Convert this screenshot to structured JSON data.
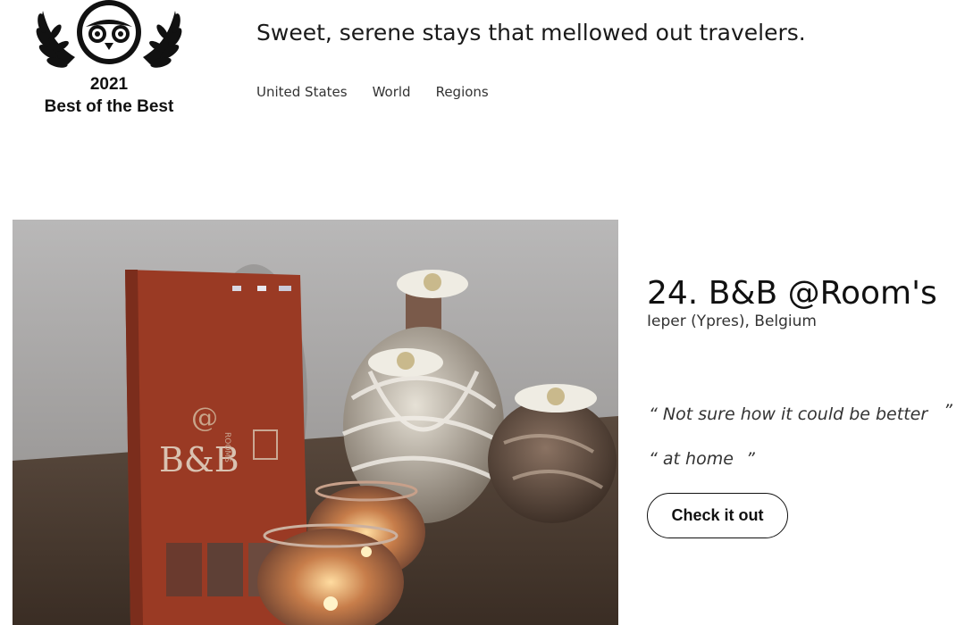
{
  "badge": {
    "year": "2021",
    "label": "Best of the Best",
    "icon": "tripadvisor-owl-laurel-icon"
  },
  "header": {
    "subtitle": "Sweet, serene stays that mellowed out travelers.",
    "tabs": [
      {
        "label": "United States"
      },
      {
        "label": "World"
      },
      {
        "label": "Regions"
      }
    ]
  },
  "listing": {
    "rank_name": "24. B&B @Room's",
    "location": "Ieper (Ypres), Belgium",
    "quotes": [
      {
        "text": "Not sure how it could be better"
      },
      {
        "text": "at home"
      }
    ],
    "cta_label": "Check it out",
    "photo": {
      "menu_brand": "B&B",
      "menu_at": "@",
      "menu_rooms": "ROOMS"
    }
  },
  "colors": {
    "background": "#ffffff",
    "text": "#111111",
    "menu_red": "#9a3a24"
  }
}
